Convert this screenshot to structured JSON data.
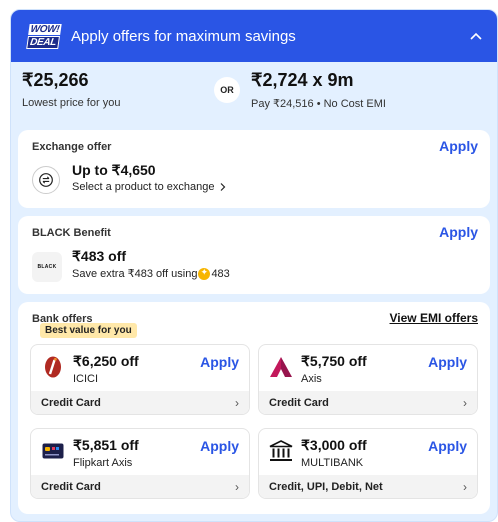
{
  "header": {
    "badge_line1": "WOW!",
    "badge_line2": "DEAL",
    "title": "Apply offers for maximum savings",
    "collapse_icon": "chevron-up-icon"
  },
  "pricing": {
    "lowest_price": "₹25,266",
    "lowest_label": "Lowest price for you",
    "or_label": "OR",
    "emi_price": "₹2,724 x 9m",
    "emi_detail": "Pay ₹24,516 • No Cost EMI"
  },
  "exchange": {
    "label": "Exchange offer",
    "apply": "Apply",
    "title": "Up to ₹4,650",
    "subtitle": "Select a product to exchange",
    "icon": "exchange-icon"
  },
  "black": {
    "label": "BLACK Benefit",
    "apply": "Apply",
    "logo_text": "BLACK",
    "title": "₹483 off",
    "subtitle_prefix": "Save extra ₹483 off using",
    "coins": "483"
  },
  "bank": {
    "label": "Bank offers",
    "view_emi": "View EMI offers",
    "best_value": "Best value for you",
    "offers": [
      {
        "amount": "₹6,250 off",
        "bank": "ICICI",
        "apply": "Apply",
        "footer": "Credit Card",
        "icon": "icici-logo-icon"
      },
      {
        "amount": "₹5,750 off",
        "bank": "Axis",
        "apply": "Apply",
        "footer": "Credit Card",
        "icon": "axis-logo-icon"
      },
      {
        "amount": "₹5,851 off",
        "bank": "Flipkart Axis",
        "apply": "Apply",
        "footer": "Credit Card",
        "icon": "flipkart-axis-card-icon"
      },
      {
        "amount": "₹3,000 off",
        "bank": "MULTIBANK",
        "apply": "Apply",
        "footer": "Credit, UPI, Debit, Net",
        "icon": "bank-building-icon"
      }
    ]
  },
  "colors": {
    "header_blue": "#2a55e5",
    "panel_bg": "#e3f0ff",
    "apply_blue": "#2a55e5",
    "badge_yellow": "#ffe8a9"
  }
}
